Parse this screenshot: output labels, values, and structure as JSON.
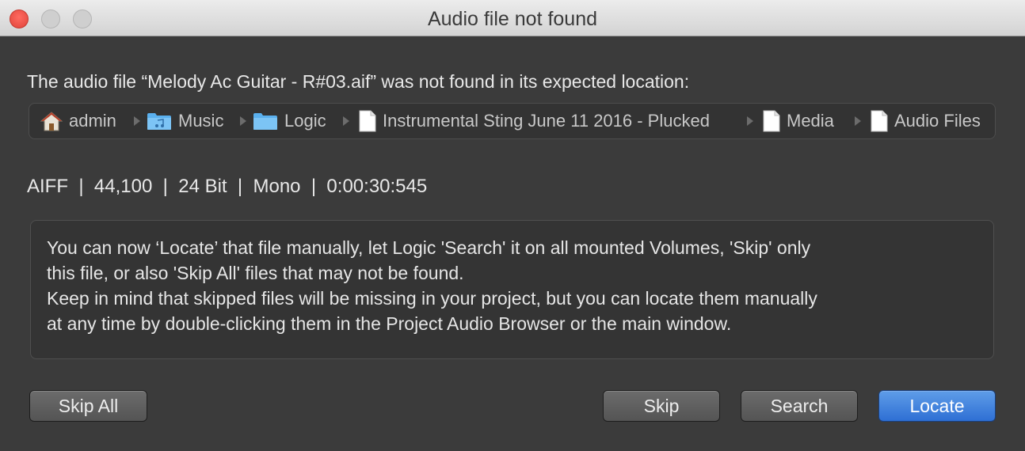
{
  "window": {
    "title": "Audio file not found"
  },
  "message": "The audio file “Melody Ac Guitar - R#03.aif” was not found in its expected location:",
  "path": [
    {
      "icon": "home-icon",
      "label": "admin"
    },
    {
      "icon": "music-folder-icon",
      "label": "Music"
    },
    {
      "icon": "folder-icon",
      "label": "Logic"
    },
    {
      "icon": "document-icon",
      "label": "Instrumental Sting June 11 2016 - Plucked"
    },
    {
      "icon": "document-icon",
      "label": "Media"
    },
    {
      "icon": "document-icon",
      "label": "Audio Files"
    }
  ],
  "file_info": "AIFF  |  44,100  |  24 Bit  |  Mono  |  0:00:30:545",
  "info_lines": [
    "You can now ‘Locate’ that file manually, let Logic 'Search' it on all mounted Volumes, 'Skip' only",
    "this file, or also 'Skip All' files that may not be found.",
    "Keep in mind that skipped files will be missing in your project, but you can locate them manually",
    "at any time by double-clicking them in the Project Audio Browser or the main window."
  ],
  "buttons": {
    "skip_all": "Skip All",
    "skip": "Skip",
    "search": "Search",
    "locate": "Locate"
  },
  "colors": {
    "primary_button": "#2e6fd4",
    "close_button": "#e0443a",
    "folder_blue": "#5ab0ee"
  }
}
